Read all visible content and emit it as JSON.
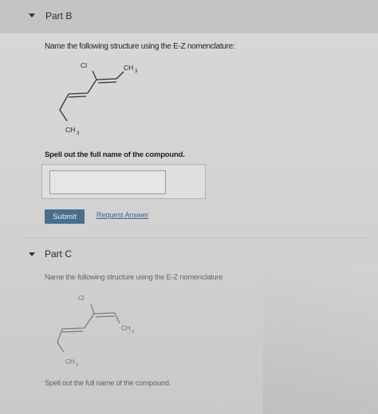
{
  "part_b": {
    "title": "Part B",
    "prompt": "Name the following structure using the E-Z nomenclature:",
    "structure": {
      "top_label": "Cl",
      "right_label": "CH",
      "bottom_label": "CH"
    },
    "instruction": "Spell out the full name of the compound.",
    "answer": {
      "value": "",
      "placeholder": ""
    },
    "submit_label": "Submit",
    "request_answer_label": "Request Answer"
  },
  "part_c": {
    "title": "Part C",
    "prompt": "Name the following structure using the E-Z nomenclature",
    "structure": {
      "top_label": "Cl",
      "right_label": "CH",
      "bottom_label": "CH"
    },
    "instruction": "Spell out the full name of the compound."
  },
  "colors": {
    "submit": "#4a6e8d",
    "link": "#3c5f9c",
    "header": "#c4c4c2"
  },
  "icons": {
    "collapse": "triangle-down-icon"
  }
}
